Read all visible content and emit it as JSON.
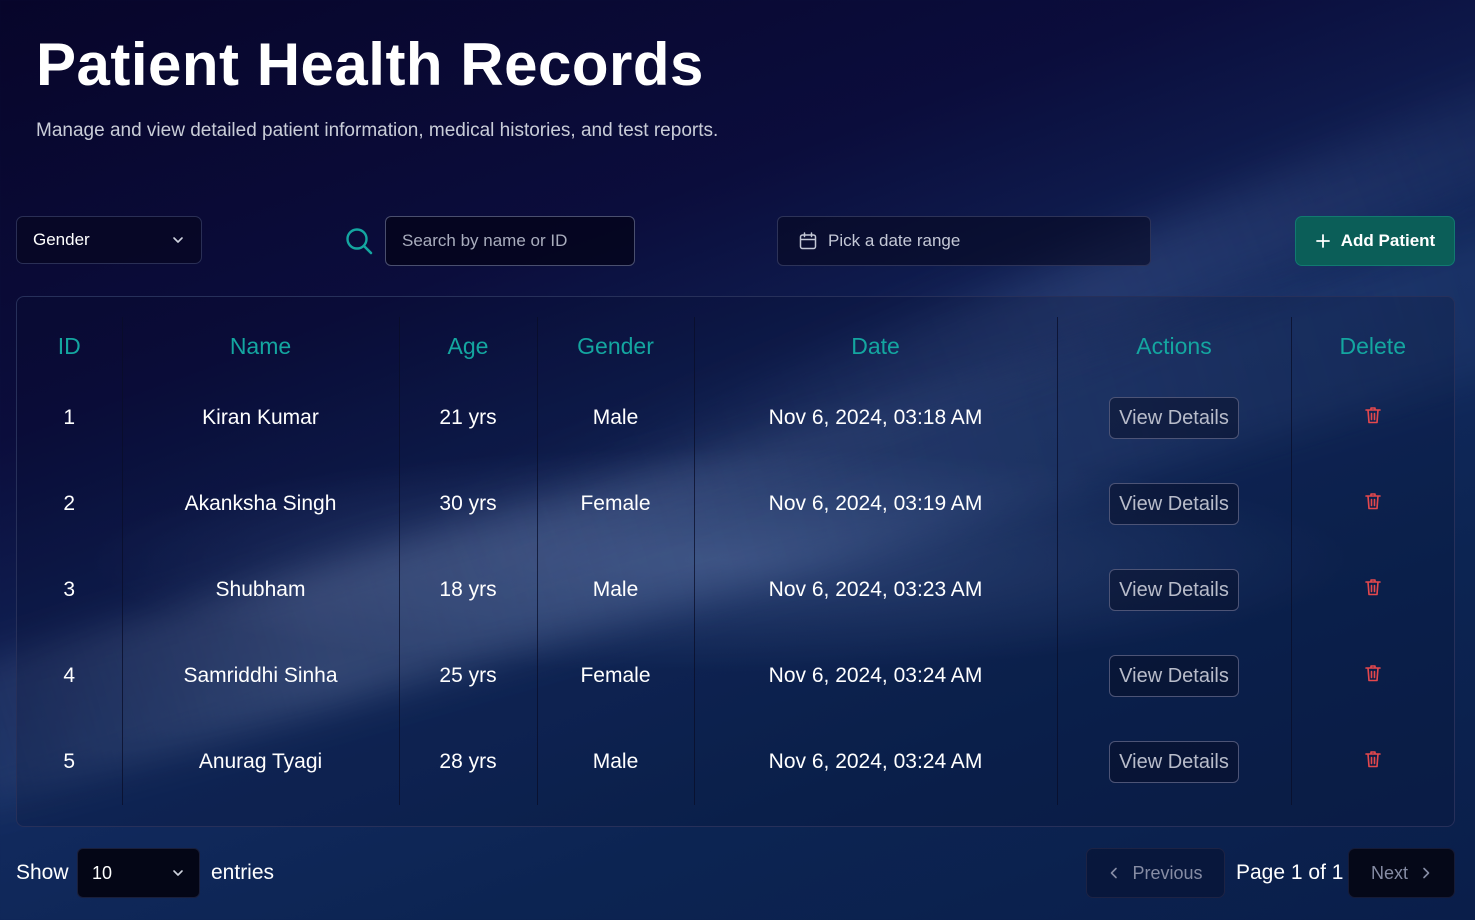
{
  "header": {
    "title": "Patient Health Records",
    "subtitle": "Manage and view detailed patient information, medical histories, and test reports."
  },
  "filters": {
    "gender_label": "Gender",
    "search_placeholder": "Search by name or ID",
    "date_range_label": "Pick a date range",
    "add_patient_label": "Add Patient"
  },
  "table": {
    "columns": [
      "ID",
      "Name",
      "Age",
      "Gender",
      "Date",
      "Actions",
      "Delete"
    ],
    "rows": [
      {
        "id": "1",
        "name": "Kiran Kumar",
        "age": "21 yrs",
        "gender": "Male",
        "date": "Nov 6, 2024, 03:18 AM",
        "action": "View Details"
      },
      {
        "id": "2",
        "name": "Akanksha Singh",
        "age": "30 yrs",
        "gender": "Female",
        "date": "Nov 6, 2024, 03:19 AM",
        "action": "View Details"
      },
      {
        "id": "3",
        "name": "Shubham",
        "age": "18 yrs",
        "gender": "Male",
        "date": "Nov 6, 2024, 03:23 AM",
        "action": "View Details"
      },
      {
        "id": "4",
        "name": "Samriddhi Sinha",
        "age": "25 yrs",
        "gender": "Female",
        "date": "Nov 6, 2024, 03:24 AM",
        "action": "View Details"
      },
      {
        "id": "5",
        "name": "Anurag Tyagi",
        "age": "28 yrs",
        "gender": "Male",
        "date": "Nov 6, 2024, 03:24 AM",
        "action": "View Details"
      }
    ]
  },
  "pagination": {
    "show_label": "Show",
    "page_size": "10",
    "entries_label": "entries",
    "previous_label": "Previous",
    "page_info": "Page 1 of 1",
    "next_label": "Next"
  },
  "icons": {
    "search": "search-icon",
    "calendar": "calendar-icon",
    "plus": "plus-icon",
    "trash": "trash-icon",
    "chevron_down": "chevron-down-icon",
    "chevron_left": "chevron-left-icon",
    "chevron_right": "chevron-right-icon"
  },
  "colors": {
    "accent_teal": "#14a6a0",
    "add_button": "#0b5e58",
    "delete_red": "#e5484d"
  }
}
